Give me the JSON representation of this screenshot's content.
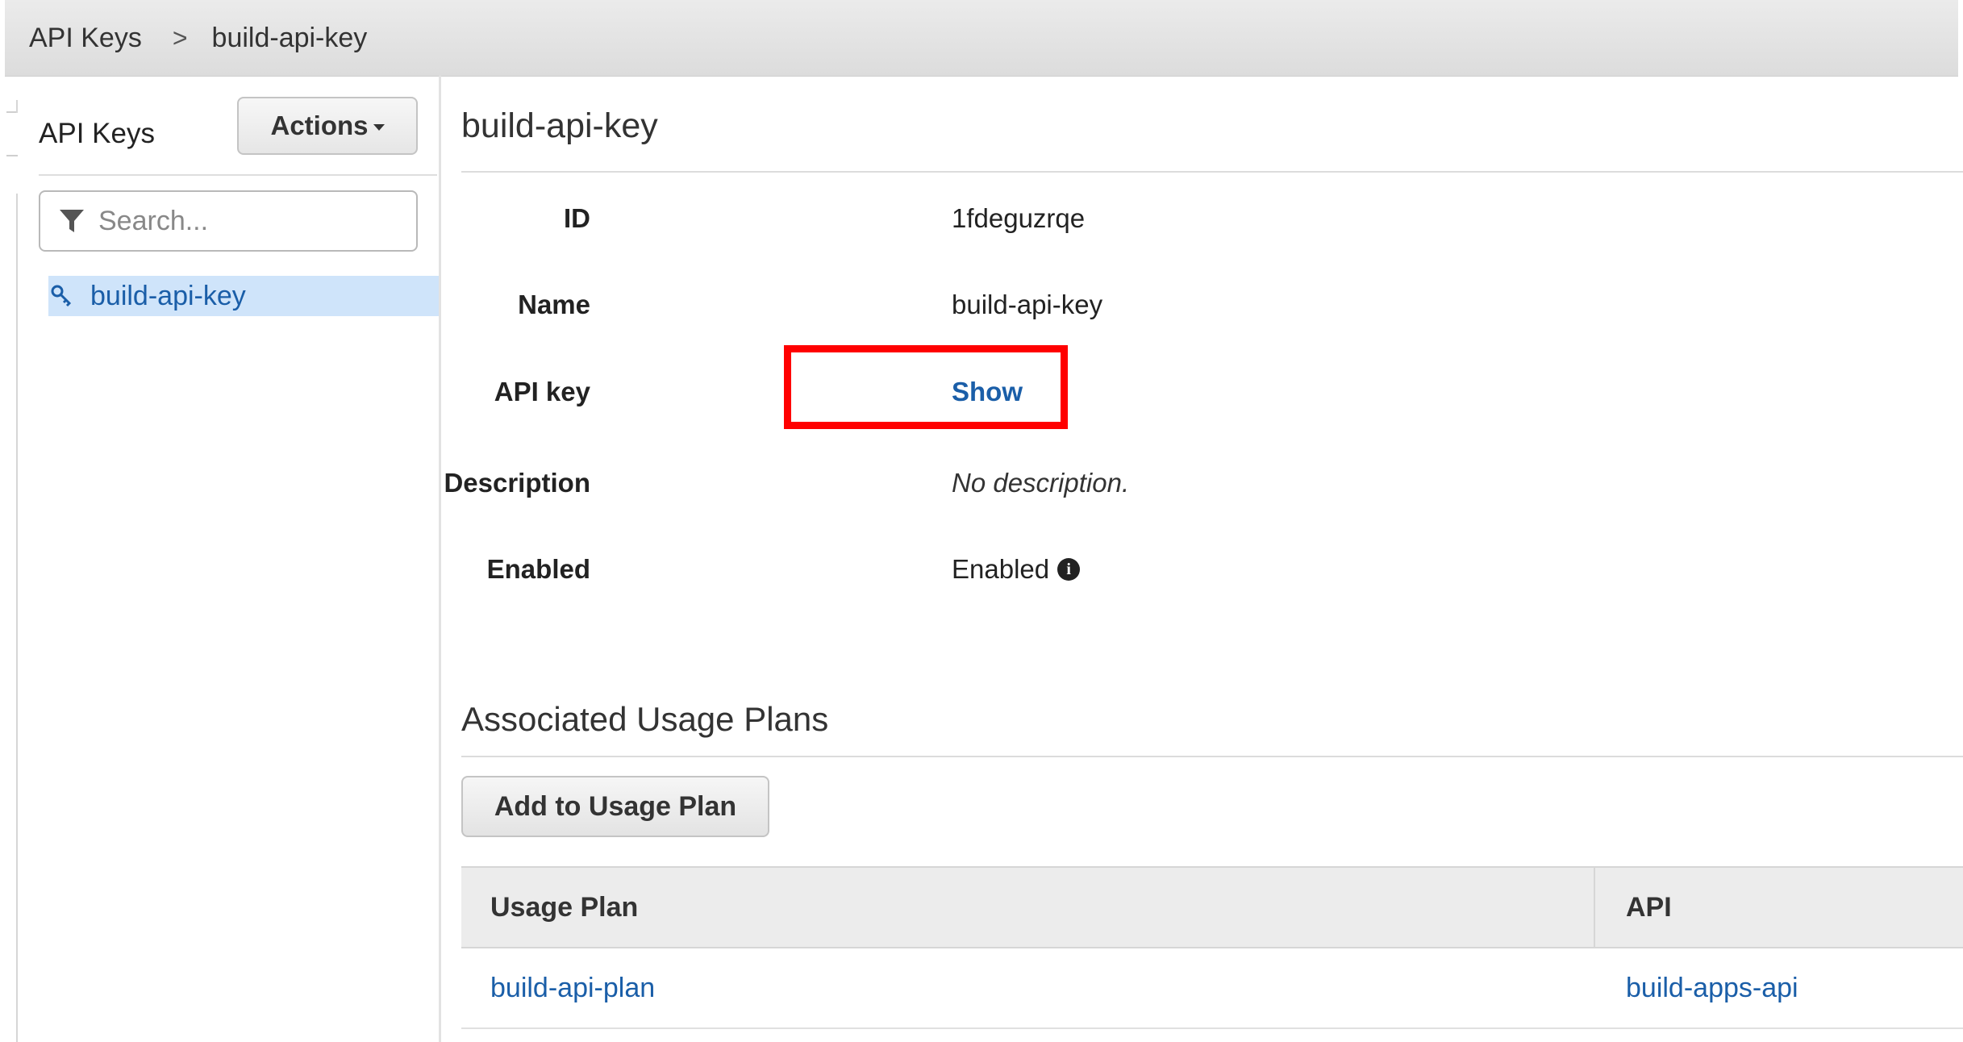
{
  "breadcrumb": {
    "items": [
      "API Keys",
      "build-api-key"
    ],
    "separator": ">"
  },
  "sidebar": {
    "title": "API Keys",
    "actions_label": "Actions",
    "search_placeholder": "Search...",
    "items": [
      {
        "label": "build-api-key",
        "selected": true,
        "icon": "key-icon"
      }
    ]
  },
  "detail": {
    "title": "build-api-key",
    "fields": [
      {
        "label": "ID",
        "value": "1fdeguzrqe"
      },
      {
        "label": "Name",
        "value": "build-api-key"
      },
      {
        "label": "API key",
        "value": "Show"
      },
      {
        "label": "Description",
        "value": "No description."
      },
      {
        "label": "Enabled",
        "value": "Enabled",
        "icon": "info-icon"
      }
    ]
  },
  "usage_plans": {
    "title": "Associated Usage Plans",
    "add_button_label": "Add to Usage Plan",
    "columns": [
      "Usage Plan",
      "API"
    ],
    "rows": [
      [
        "build-api-plan",
        "build-apps-api"
      ]
    ]
  },
  "colors": {
    "link": "#1a5ea8",
    "selected_bg": "#cfe4fa",
    "highlight": "#ff0000"
  }
}
